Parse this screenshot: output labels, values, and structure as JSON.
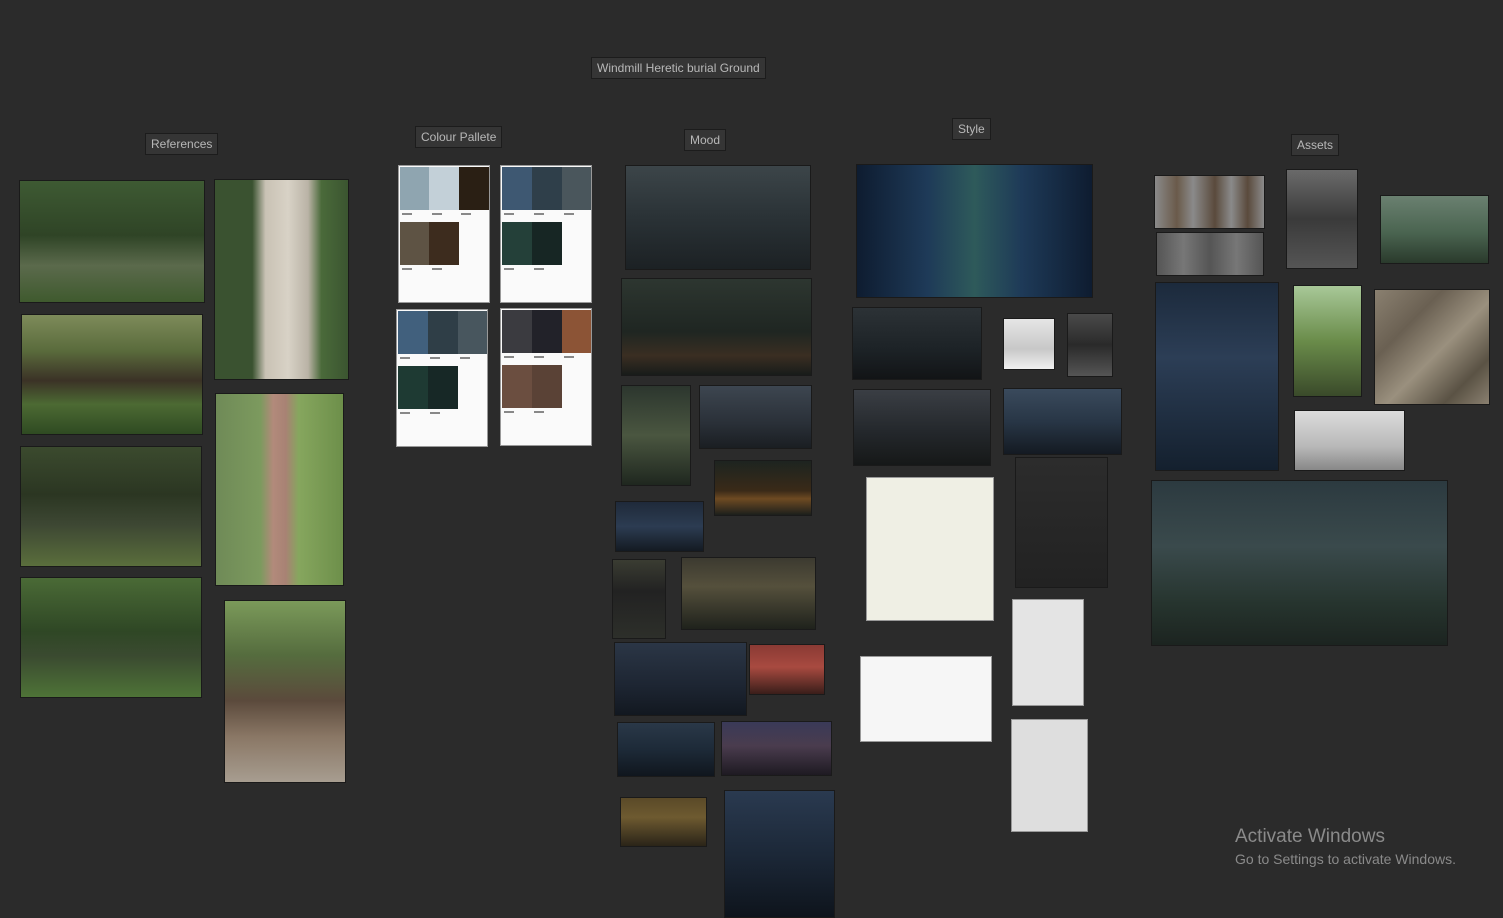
{
  "board": {
    "title": "Windmill Heretic burial Ground",
    "sections": {
      "references": "References",
      "colour": "Colour Pallete",
      "mood": "Mood",
      "style": "Style",
      "assets": "Assets"
    }
  },
  "palettes": [
    {
      "colors": [
        "#8fa5b0",
        "#c3d0d8",
        "#2a1f14",
        "#5e5344",
        "#3d2c1e"
      ]
    },
    {
      "colors": [
        "#3e5872",
        "#2f3f4a",
        "#4a565c",
        "#244039",
        "#172624"
      ]
    },
    {
      "colors": [
        "#41607d",
        "#2f3e47",
        "#48565e",
        "#1e3a33",
        "#172826"
      ]
    },
    {
      "colors": [
        "#3b3b40",
        "#222229",
        "#8c5436",
        "#6b4e40",
        "#5a4236"
      ]
    }
  ],
  "windows_watermark": {
    "title": "Activate Windows",
    "subtitle": "Go to Settings to activate Windows."
  }
}
